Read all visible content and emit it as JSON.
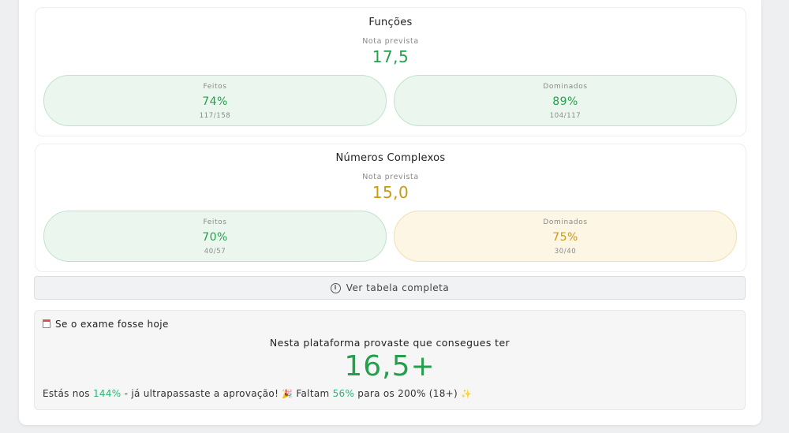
{
  "modules": [
    {
      "title": "Funções",
      "nota_label": "Nota prevista",
      "nota_value": "17,5",
      "feitos": {
        "label": "Feitos",
        "percent": "74%",
        "count": "117/158"
      },
      "dominados": {
        "label": "Dominados",
        "percent": "89%",
        "count": "104/117"
      }
    },
    {
      "title": "Números Complexos",
      "nota_label": "Nota prevista",
      "nota_value": "15,0",
      "feitos": {
        "label": "Feitos",
        "percent": "70%",
        "count": "40/57"
      },
      "dominados": {
        "label": "Dominados",
        "percent": "75%",
        "count": "30/40"
      }
    }
  ],
  "table_button": {
    "label": "Ver tabela completa",
    "icon": "info-circle-icon"
  },
  "exam": {
    "icon": "calendar-icon",
    "heading": "Se o exame fosse hoje",
    "subtitle": "Nesta plataforma provaste que consegues ter",
    "grade": "16,5+",
    "line_prefix": "Estás nos ",
    "line_pct": "144%",
    "line_middle": " - já ultrapassaste a aprovação! ",
    "party_emoji": "🎉",
    "line_faltam": " Faltam ",
    "line_pct2": "56%",
    "line_suffix": " para os 200% (18+) ",
    "sparkle_emoji": "✨"
  },
  "colors": {
    "green": "#23a04c",
    "gold": "#c99a12",
    "green_pill_bg": "#ebf7ee",
    "yellow_pill_bg": "#fdf6e5"
  }
}
